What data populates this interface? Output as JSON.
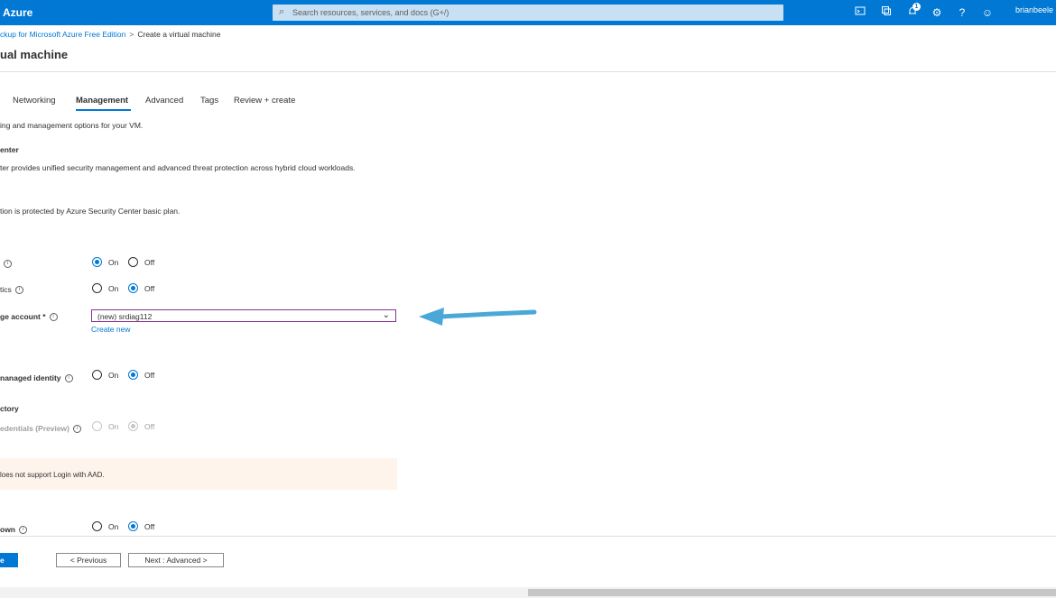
{
  "header": {
    "brand": "Azure",
    "search_placeholder": "Search resources, services, and docs (G+/)",
    "notification_count": "1",
    "user": "brianbeele"
  },
  "breadcrumb": {
    "link": "ckup for Microsoft Azure Free Edition",
    "separator": ">",
    "current": "Create a virtual machine"
  },
  "page": {
    "title": "ual machine"
  },
  "tabs": [
    "Networking",
    "Management",
    "Advanced",
    "Tags",
    "Review + create"
  ],
  "selected_tab": "Management",
  "intro": "ing and management options for your VM.",
  "security_center": {
    "heading": "enter",
    "description": "ter provides unified security management and advanced threat protection across hybrid cloud workloads.",
    "status": "tion is protected by Azure Security Center basic plan."
  },
  "monitoring": {
    "boot_diag_label": "",
    "os_diag_label": "tics",
    "storage_label": "ge account *",
    "storage_value": "(new) srdiag112",
    "create_new": "Create new"
  },
  "identity": {
    "label": "nanaged identity"
  },
  "aad": {
    "heading": "ctory",
    "label": "edentials (Preview)",
    "warning": "loes not support Login with AAD."
  },
  "shutdown": {
    "label": "own"
  },
  "radio": {
    "on": "On",
    "off": "Off"
  },
  "footer": {
    "review_label": "e",
    "previous_label": "< Previous",
    "next_label": "Next : Advanced >"
  },
  "colors": {
    "accent": "#0078d4",
    "annotation_arrow": "#4aa8d8",
    "warning_bg": "#fff4ec"
  }
}
